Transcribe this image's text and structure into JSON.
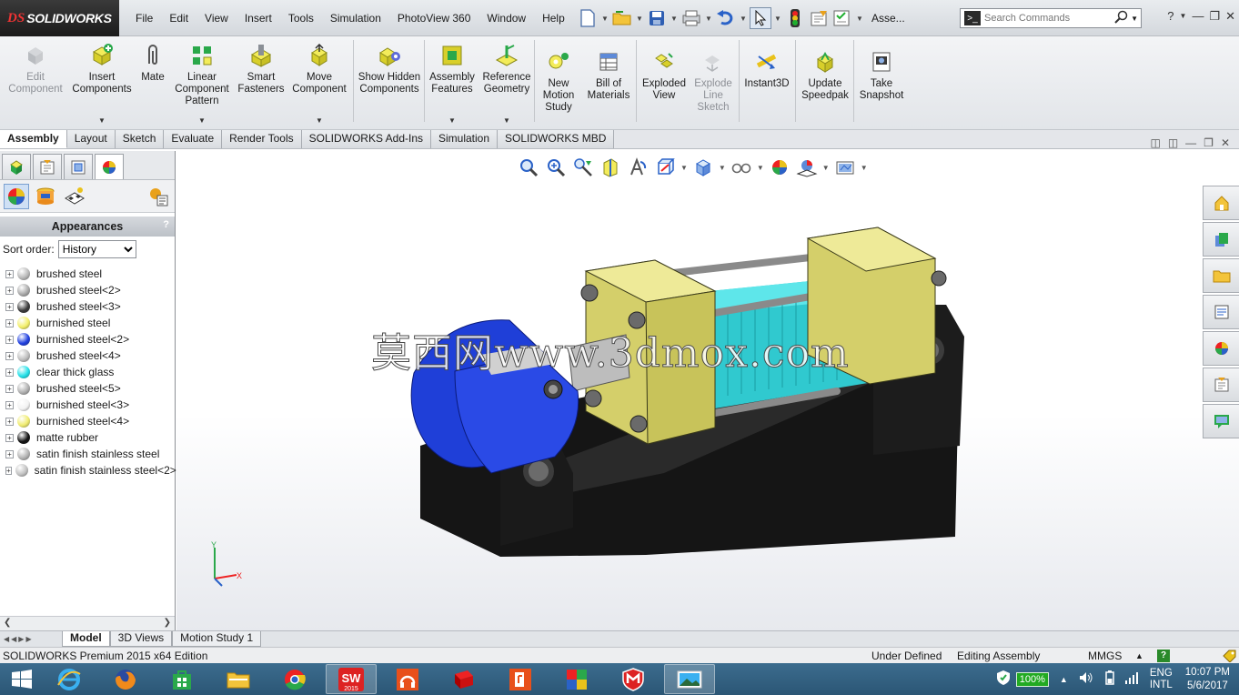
{
  "brand": {
    "ds": "DS",
    "name": "SOLIDWORKS"
  },
  "menu": [
    "File",
    "Edit",
    "View",
    "Insert",
    "Tools",
    "Simulation",
    "PhotoView 360",
    "Window",
    "Help"
  ],
  "doc_name": "Asse...",
  "search": {
    "placeholder": "Search Commands"
  },
  "ribbon": {
    "edit_component": "Edit Component",
    "insert_components": "Insert Components",
    "mate": "Mate",
    "linear_pattern": "Linear Component Pattern",
    "smart_fasteners": "Smart Fasteners",
    "move_component": "Move Component",
    "show_hidden": "Show Hidden Components",
    "assembly_features": "Assembly Features",
    "reference_geometry": "Reference Geometry",
    "new_motion_study": "New Motion Study",
    "bill_of_materials": "Bill of Materials",
    "exploded_view": "Exploded View",
    "explode_line_sketch": "Explode Line Sketch",
    "instant3d": "Instant3D",
    "update_speedpak": "Update Speedpak",
    "take_snapshot": "Take Snapshot"
  },
  "tabs": [
    "Assembly",
    "Layout",
    "Sketch",
    "Evaluate",
    "Render Tools",
    "SOLIDWORKS Add-Ins",
    "Simulation",
    "SOLIDWORKS MBD"
  ],
  "appearances": {
    "title": "Appearances",
    "help": "?",
    "sort_label": "Sort order:",
    "sort_value": "History",
    "items": [
      {
        "label": "brushed steel",
        "color": "#b8b8b8"
      },
      {
        "label": "brushed steel<2>",
        "color": "#a9a9a9"
      },
      {
        "label": "brushed steel<3>",
        "color": "#3a3a3a"
      },
      {
        "label": "burnished steel",
        "color": "#f3ef6a"
      },
      {
        "label": "burnished steel<2>",
        "color": "#1f3fe0"
      },
      {
        "label": "brushed steel<4>",
        "color": "#bdbdbd"
      },
      {
        "label": "clear thick glass",
        "color": "#22e0e8"
      },
      {
        "label": "brushed steel<5>",
        "color": "#b0b0b0"
      },
      {
        "label": "burnished steel<3>",
        "color": "#f2f2f2"
      },
      {
        "label": "burnished steel<4>",
        "color": "#f0ec70"
      },
      {
        "label": "matte rubber",
        "color": "#111111"
      },
      {
        "label": "satin finish stainless steel",
        "color": "#b3b3b3"
      },
      {
        "label": "satin finish stainless steel<2>",
        "color": "#c2c2c2"
      }
    ]
  },
  "watermark": "莫西网www.3dmox.com",
  "triad": {
    "x": "X",
    "y": "Y"
  },
  "bottom_tabs": [
    "Model",
    "3D Views",
    "Motion Study 1"
  ],
  "status": {
    "edition": "SOLIDWORKS Premium 2015 x64 Edition",
    "defined": "Under Defined",
    "editing": "Editing Assembly",
    "units": "MMGS",
    "units_arrow": "▲",
    "help": "?"
  },
  "tray": {
    "battery": "100%",
    "lang1": "ENG",
    "lang2": "INTL",
    "time": "10:07 PM",
    "date": "5/6/2017"
  },
  "sw_badge": "2015"
}
